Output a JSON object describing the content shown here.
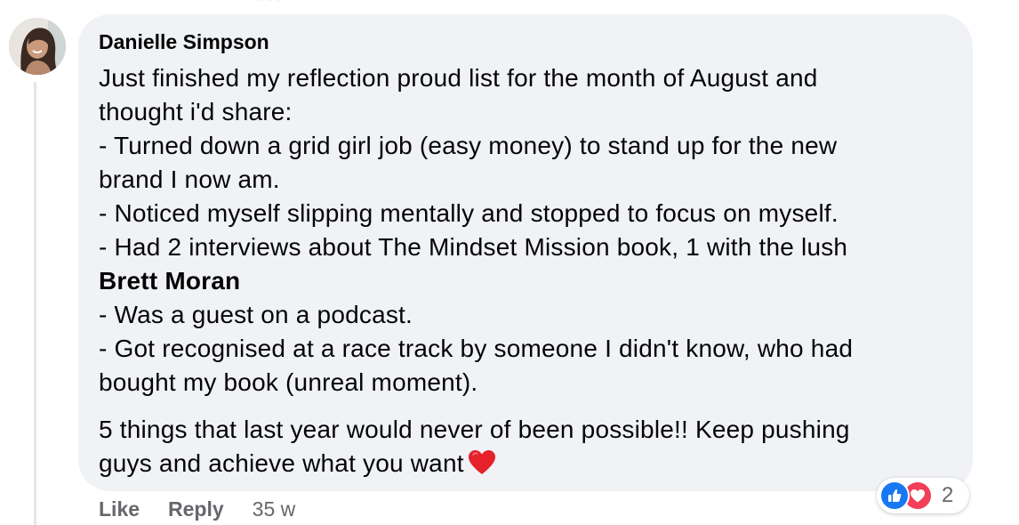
{
  "comment": {
    "author": "Danielle Simpson",
    "lines": [
      "Just finished my reflection proud list for the month of August and",
      "thought i'd share:",
      "- Turned down a grid girl job (easy money) to stand up for the new",
      "brand I now am.",
      "- Noticed myself slipping mentally and stopped to focus on myself.",
      "- Had 2 interviews about The Mindset Mission book, 1 with the lush"
    ],
    "mention": "Brett Moran",
    "lines_after_mention": [
      "- Was a guest on a podcast.",
      "- Got recognised at a race track by someone I didn't know, who had",
      "bought my book (unreal moment)."
    ],
    "closing_lines": [
      "5 things that last year would never of been possible!! Keep pushing",
      "guys and achieve what you want"
    ],
    "closing_emoji": "red-heart-emoji"
  },
  "actions": {
    "like_label": "Like",
    "reply_label": "Reply",
    "timestamp": "35 w"
  },
  "reactions": {
    "icons": [
      "like-icon",
      "love-icon"
    ],
    "count": "2"
  },
  "colors": {
    "bubble": "#f0f2f5",
    "text": "#050505",
    "secondary_text": "#65676b",
    "like_blue": "#1877f2",
    "love_red": "#f33e58",
    "thread_line": "#e4e6eb"
  }
}
